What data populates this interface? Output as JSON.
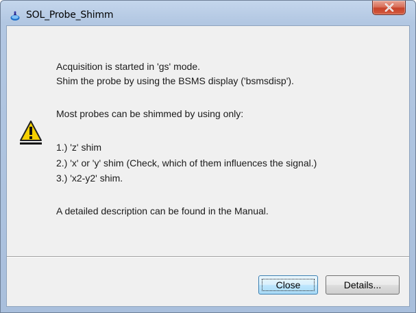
{
  "window": {
    "title": "SOL_Probe_Shimm"
  },
  "message": {
    "lines": [
      "Acquisition is started in 'gs' mode.",
      "Shim the probe by using the BSMS display ('bsmsdisp').",
      "Most probes can be shimmed by using only:",
      "1.) 'z' shim",
      "2.) 'x' or 'y' shim (Check, which of them influences the signal.)",
      "3.) 'x2-y2' shim.",
      "A detailed description can be found in the Manual."
    ]
  },
  "buttons": {
    "close_label": "Close",
    "details_label": "Details..."
  },
  "icons": {
    "app": "app-icon",
    "warning": "warning-icon",
    "close": "close-icon"
  },
  "colors": {
    "close_button": "#c7432a",
    "warning_yellow": "#f5d000"
  }
}
